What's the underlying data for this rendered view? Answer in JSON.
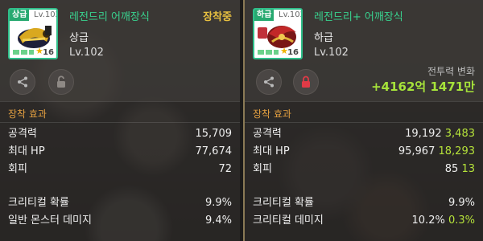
{
  "left": {
    "grade_tag": "상급",
    "level_tag": "Lv.102",
    "star_count": "16",
    "name": "레전드리 어깨장식",
    "equipped": "장착중",
    "grade": "상급",
    "level": "Lv.102",
    "section_title": "장착 효과",
    "stats_primary": [
      {
        "label": "공격력",
        "value": "15,709"
      },
      {
        "label": "최대 HP",
        "value": "77,674"
      },
      {
        "label": "회피",
        "value": "72"
      }
    ],
    "stats_secondary": [
      {
        "label": "크리티컬 확률",
        "value": "9.9%"
      },
      {
        "label": "일반 몬스터 데미지",
        "value": "9.4%"
      }
    ]
  },
  "right": {
    "grade_tag": "하급",
    "level_tag": "Lv.102",
    "star_count": "16",
    "name": "레전드리+ 어깨장식",
    "grade": "하급",
    "level": "Lv.102",
    "power_label": "전투력 변화",
    "power_value": "+4162억 1471만",
    "section_title": "장착 효과",
    "stats_primary": [
      {
        "label": "공격력",
        "value": "19,192",
        "bonus": "3,483"
      },
      {
        "label": "최대 HP",
        "value": "95,967",
        "bonus": "18,293"
      },
      {
        "label": "회피",
        "value": "85",
        "bonus": "13"
      }
    ],
    "stats_secondary": [
      {
        "label": "크리티컬 확률",
        "value": "9.9%",
        "bonus": ""
      },
      {
        "label": "크리티컬 데미지",
        "value": "10.2%",
        "bonus": "0.3%"
      }
    ]
  },
  "colors": {
    "name_green": "#39d28f",
    "equipped_gold": "#e8c040",
    "section_orange": "#e4a040",
    "bonus_green": "#b6e33a"
  },
  "icons": [
    "share-icon",
    "unlock-icon",
    "lock-icon",
    "star-icon"
  ]
}
